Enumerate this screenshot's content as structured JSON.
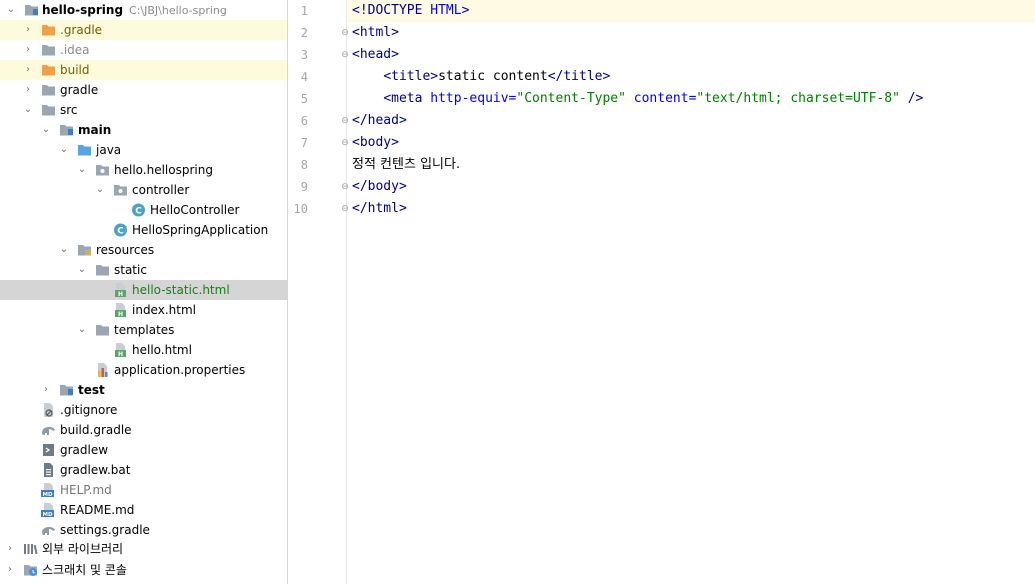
{
  "project_tree": {
    "root": {
      "name": "hello-spring",
      "path": "C:\\JBJ\\hello-spring"
    },
    "items": [
      {
        "label": ".gradle"
      },
      {
        "label": ".idea"
      },
      {
        "label": "build"
      },
      {
        "label": "gradle"
      },
      {
        "label": "src"
      },
      {
        "label": "main"
      },
      {
        "label": "java"
      },
      {
        "label": "hello.hellospring"
      },
      {
        "label": "controller"
      },
      {
        "label": "HelloController"
      },
      {
        "label": "HelloSpringApplication"
      },
      {
        "label": "resources"
      },
      {
        "label": "static"
      },
      {
        "label": "hello-static.html"
      },
      {
        "label": "index.html"
      },
      {
        "label": "templates"
      },
      {
        "label": "hello.html"
      },
      {
        "label": "application.properties"
      },
      {
        "label": "test"
      },
      {
        "label": ".gitignore"
      },
      {
        "label": "build.gradle"
      },
      {
        "label": "gradlew"
      },
      {
        "label": "gradlew.bat"
      },
      {
        "label": "HELP.md"
      },
      {
        "label": "README.md"
      },
      {
        "label": "settings.gradle"
      },
      {
        "label": "외부 라이브러리"
      },
      {
        "label": "스크래치 및 콘솔"
      }
    ]
  },
  "editor": {
    "line_numbers": [
      "1",
      "2",
      "3",
      "4",
      "5",
      "6",
      "7",
      "8",
      "9",
      "10"
    ],
    "lines": [
      {
        "p1": "<!DOCTYPE ",
        "p2": "HTML",
        "p3": ">"
      },
      {
        "open": "<",
        "tag": "html",
        "close": ">"
      },
      {
        "open": "<",
        "tag": "head",
        "close": ">"
      },
      {
        "indent": "    ",
        "open": "<",
        "tag": "title",
        "close": ">",
        "text": "static content",
        "open2": "</",
        "tag2": "title",
        "close2": ">"
      },
      {
        "indent": "    ",
        "open": "<",
        "tag": "meta",
        "attr1": " http-equiv=",
        "val1": "\"Content-Type\"",
        "attr2": " content=",
        "val2": "\"text/html; charset=UTF-8\"",
        "close": " />"
      },
      {
        "open": "</",
        "tag": "head",
        "close": ">"
      },
      {
        "open": "<",
        "tag": "body",
        "close": ">"
      },
      {
        "text": "정적 컨텐츠 입니다."
      },
      {
        "open": "</",
        "tag": "body",
        "close": ">"
      },
      {
        "open": "</",
        "tag": "html",
        "close": ">"
      }
    ]
  },
  "colors": {
    "tag": "#000080",
    "attribute": "#0000ff",
    "string": "#008000",
    "selection": "#d5d5d5",
    "ignored_highlight": "#fdfbdc",
    "folder_excluded": "#f0a04a",
    "folder_source": "#5aa5e0",
    "folder_plain": "#9aa6b2"
  }
}
